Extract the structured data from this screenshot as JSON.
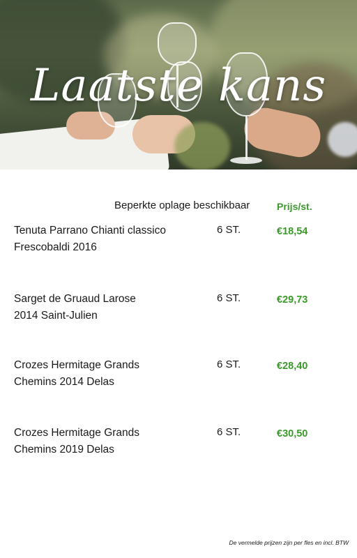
{
  "hero": {
    "title": "Laatste kans"
  },
  "table": {
    "header_note": "Beperkte oplage beschikbaar",
    "price_header": "Prijs/st.",
    "rows": [
      {
        "name_line1": "Tenuta Parrano Chianti classico",
        "name_line2": "Frescobaldi 2016",
        "qty": "6 ST.",
        "price": "€18,54"
      },
      {
        "name_line1": "Sarget de Gruaud Larose",
        "name_line2": "2014 Saint-Julien",
        "qty": "6 ST.",
        "price": "€29,73"
      },
      {
        "name_line1": "Crozes Hermitage Grands",
        "name_line2": "Chemins 2014 Delas",
        "qty": "6 ST.",
        "price": "€28,40"
      },
      {
        "name_line1": "Crozes Hermitage Grands",
        "name_line2": "Chemins 2019  Delas",
        "qty": "6 ST.",
        "price": "€30,50"
      }
    ]
  },
  "footnote": "De vermelde prijzen zijn per fles en incl. BTW",
  "colors": {
    "accent_green": "#3a9a2a",
    "text": "#1a1a1a",
    "background": "#ffffff"
  }
}
